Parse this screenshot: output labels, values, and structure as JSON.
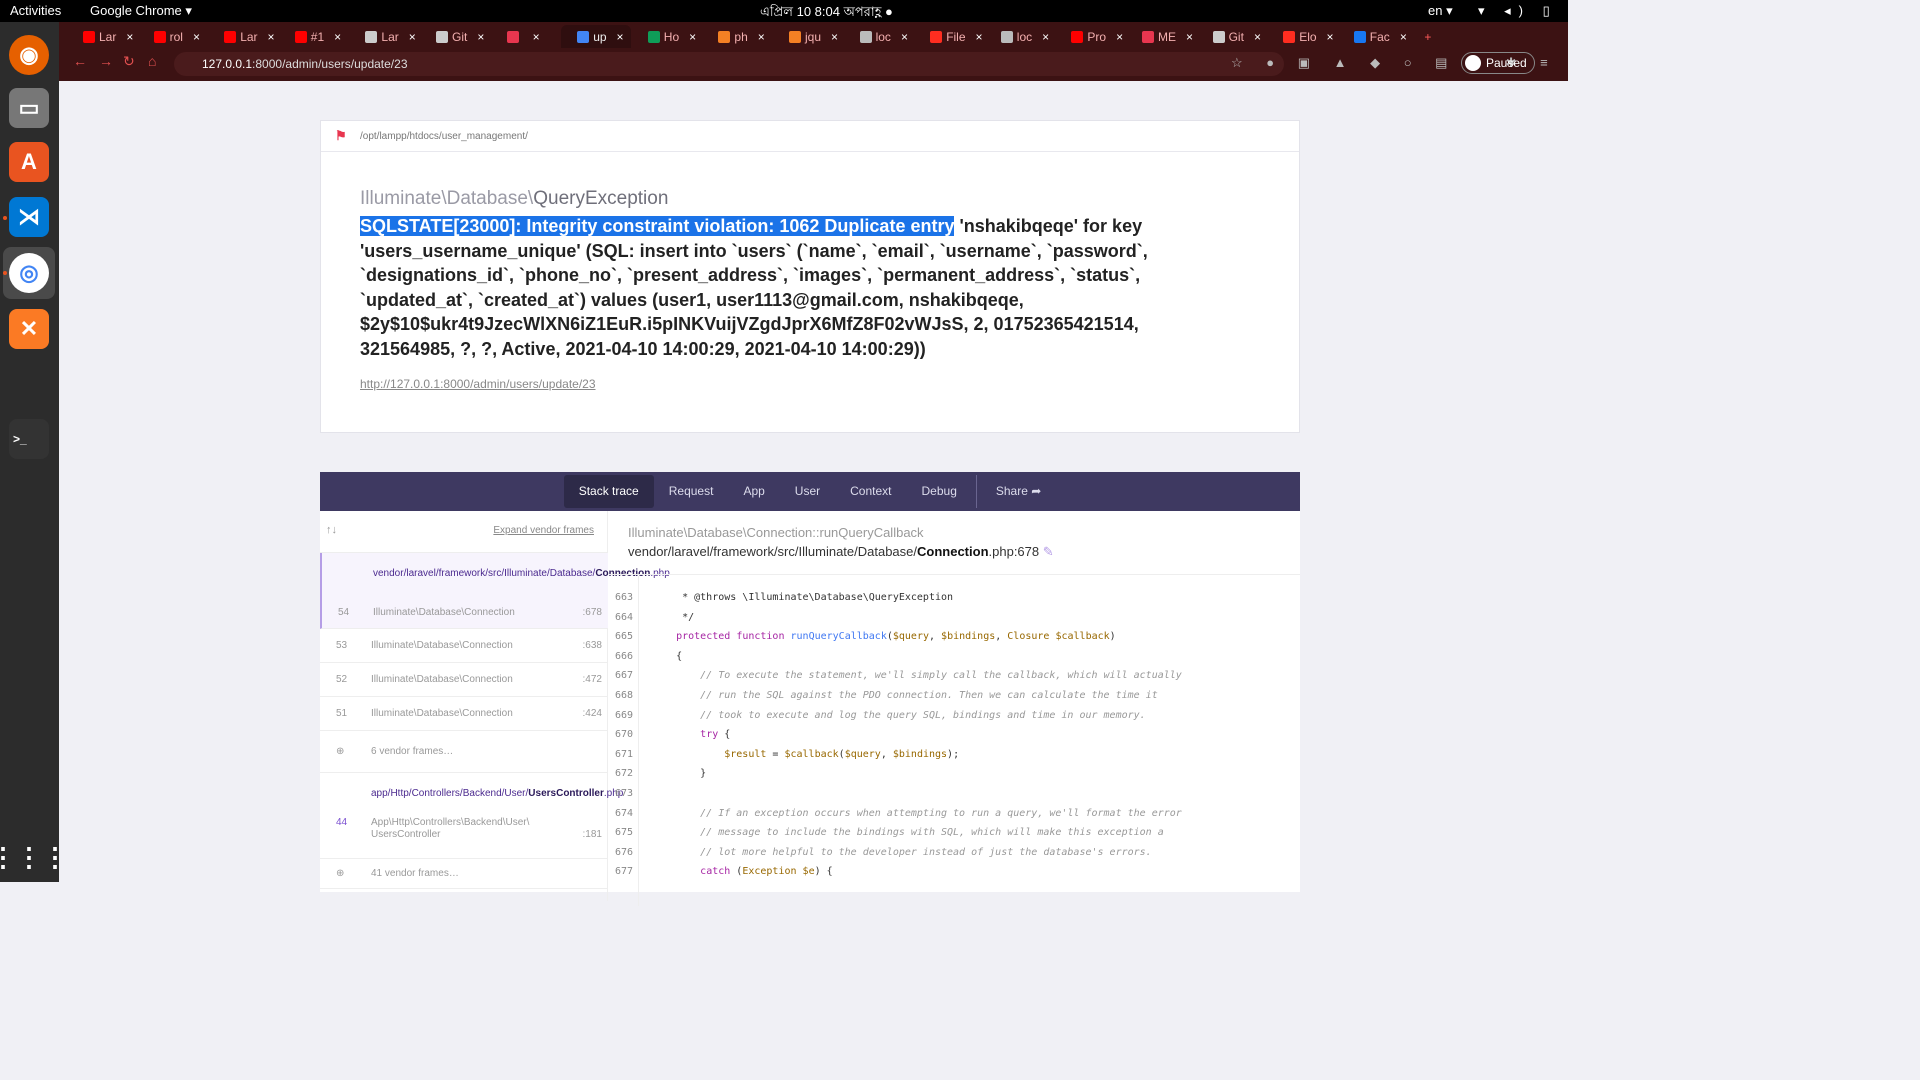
{
  "topbar": {
    "activities": "Activities",
    "app": "Google Chrome ▾",
    "clock": "এপ্রিল 10  8:04 অপরাহ্ণ  ●",
    "lang": "en ▾",
    "sys": "▾ ◂) ▯ ▾"
  },
  "tabs": [
    {
      "label": "Lar",
      "color": "#ff0000"
    },
    {
      "label": "rol",
      "color": "#ff0000"
    },
    {
      "label": "Lar",
      "color": "#ff0000"
    },
    {
      "label": "#1",
      "color": "#ff0000"
    },
    {
      "label": "Lar",
      "color": "#cccccc"
    },
    {
      "label": "Git",
      "color": "#cccccc"
    },
    {
      "label": "",
      "color": "#e8364f"
    },
    {
      "label": "up",
      "color": "#4285f4"
    },
    {
      "label": "Ho",
      "color": "#0f9d58"
    },
    {
      "label": "ph",
      "color": "#f48024"
    },
    {
      "label": "jqu",
      "color": "#f48024"
    },
    {
      "label": "loc",
      "color": "#bbbbbb"
    },
    {
      "label": "File",
      "color": "#ff2d20"
    },
    {
      "label": "loc",
      "color": "#bbbbbb"
    },
    {
      "label": "Pro",
      "color": "#ff0000"
    },
    {
      "label": "ME",
      "color": "#e8364f"
    },
    {
      "label": "Git",
      "color": "#cccccc"
    },
    {
      "label": "Elo",
      "color": "#ff2d20"
    },
    {
      "label": "Fac",
      "color": "#1877f2"
    }
  ],
  "browser": {
    "url_host": "127.0.0.1",
    "url_path": ":8000/admin/users/update/23",
    "paused": "Paused"
  },
  "error": {
    "path": "/opt/lampp/htdocs/user_management/",
    "namespace": "Illuminate\\Database\\",
    "class": "QueryException",
    "highlight": "SQLSTATE[23000]: Integrity constraint violation: 1062 Duplicate entry",
    "message": " 'nshakibqeqe' for key 'users_username_unique' (SQL: insert into `users` (`name`, `email`, `username`, `password`, `designations_id`, `phone_no`, `present_address`, `images`, `permanent_address`, `status`, `updated_at`, `created_at`) values (user1, user1113@gmail.com, nshakibqeqe, $2y$10$ukr4t9JzecWlXN6iZ1EuR.i5pINKVuijVZgdJprX6MfZ8F02vWJsS, 2, 01752365421514, 321564985, ?, ?, Active, 2021-04-10 14:00:29, 2021-04-10 14:00:29))",
    "url": "http://127.0.0.1:8000/admin/users/update/23"
  },
  "menu": [
    "Stack trace",
    "Request",
    "App",
    "User",
    "Context",
    "Debug"
  ],
  "share": "Share ➦",
  "frames_head": {
    "arrows": "↑↓",
    "expand": "Expand vendor frames"
  },
  "frames": [
    {
      "num": "54",
      "path_pre": "vendor/laravel/framework/src/Illuminate/Database/",
      "path_file": "Connection",
      "path_ext": ".php",
      "cls": "Illuminate\\Database\\Connection",
      "line": ":678"
    },
    {
      "num": "53",
      "cls": "Illuminate\\Database\\Connection",
      "line": ":638"
    },
    {
      "num": "52",
      "cls": "Illuminate\\Database\\Connection",
      "line": ":472"
    },
    {
      "num": "51",
      "cls": "Illuminate\\Database\\Connection",
      "line": ":424"
    },
    {
      "num": "⊕",
      "cls": "6 vendor frames…",
      "line": ""
    },
    {
      "num": "44",
      "path_pre": "app/Http/Controllers/Backend/User/",
      "path_file": "UsersController",
      "path_ext": ".php",
      "cls": "App\\Http\\Controllers\\Backend\\User\\ UsersController",
      "line": ":181"
    },
    {
      "num": "⊕",
      "cls": "41 vendor frames…",
      "line": ""
    }
  ],
  "code_head": {
    "ns": "Illuminate\\Database\\Connection::runQueryCallback",
    "file_pre": "vendor/laravel/framework/src/Illuminate/Database/",
    "file": "Connection",
    "file_post": ".php:678"
  },
  "code": [
    {
      "n": "663",
      "t": "     * @throws \\Illuminate\\Database\\QueryException"
    },
    {
      "n": "664",
      "t": "     */"
    },
    {
      "n": "665",
      "t": "    protected function runQueryCallback($query, $bindings, Closure $callback)"
    },
    {
      "n": "666",
      "t": "    {"
    },
    {
      "n": "667",
      "t": "        // To execute the statement, we'll simply call the callback, which will actually"
    },
    {
      "n": "668",
      "t": "        // run the SQL against the PDO connection. Then we can calculate the time it"
    },
    {
      "n": "669",
      "t": "        // took to execute and log the query SQL, bindings and time in our memory."
    },
    {
      "n": "670",
      "t": "        try {"
    },
    {
      "n": "671",
      "t": "            $result = $callback($query, $bindings);"
    },
    {
      "n": "672",
      "t": "        }"
    },
    {
      "n": "673",
      "t": ""
    },
    {
      "n": "674",
      "t": "        // If an exception occurs when attempting to run a query, we'll format the error"
    },
    {
      "n": "675",
      "t": "        // message to include the bindings with SQL, which will make this exception a"
    },
    {
      "n": "676",
      "t": "        // lot more helpful to the developer instead of just the database's errors."
    },
    {
      "n": "677",
      "t": "        catch (Exception $e) {"
    }
  ]
}
